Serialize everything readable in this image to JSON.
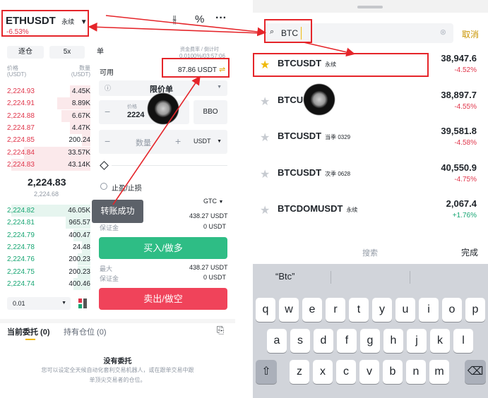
{
  "left": {
    "pair": "ETHUSDT",
    "pair_tag": "永续",
    "pair_change": "-6.53%",
    "funding": "资金费率 / 倒计时",
    "funding_value": "0.0100%/03:57:06",
    "margin_mode": "逐仓",
    "leverage": "5x",
    "position_mode": "单",
    "col_price": "价格",
    "col_price_unit": "(USDT)",
    "col_qty": "数量",
    "col_qty_unit": "(USDT)",
    "asks": [
      {
        "price": "2,224.93",
        "qty": "4.45K",
        "depth": 0.25
      },
      {
        "price": "2,224.91",
        "qty": "8.89K",
        "depth": 0.4
      },
      {
        "price": "2,224.88",
        "qty": "6.67K",
        "depth": 0.35
      },
      {
        "price": "2,224.87",
        "qty": "4.47K",
        "depth": 0.25
      },
      {
        "price": "2,224.85",
        "qty": "200.24",
        "depth": 0.1
      },
      {
        "price": "2,224.84",
        "qty": "33.57K",
        "depth": 0.8
      },
      {
        "price": "2,224.83",
        "qty": "43.14K",
        "depth": 0.95
      }
    ],
    "last_price": "2,224.83",
    "mark_price": "2,224.68",
    "bids": [
      {
        "price": "2,224.82",
        "qty": "46.05K",
        "depth": 0.95
      },
      {
        "price": "2,224.81",
        "qty": "965.57",
        "depth": 0.3
      },
      {
        "price": "2,224.79",
        "qty": "400.47",
        "depth": 0.2
      },
      {
        "price": "2,224.78",
        "qty": "24.48",
        "depth": 0.1
      },
      {
        "price": "2,224.76",
        "qty": "200.23",
        "depth": 0.15
      },
      {
        "price": "2,224.75",
        "qty": "200.23",
        "depth": 0.15
      },
      {
        "price": "2,224.74",
        "qty": "400.46",
        "depth": 0.2
      }
    ],
    "tick_size": "0.01",
    "available_label": "可用",
    "available_value": "87.86 USDT",
    "order_type": "限价单",
    "price_label": "价格",
    "price_value": "2224",
    "bbo": "BBO",
    "qty_label": "数量",
    "qty_unit": "USDT",
    "tpsl_label": "止盈/止损",
    "tif": "GTC",
    "toast": "转账成功",
    "buy_max_value": "438.27 USDT",
    "buy_margin_label": "保证金",
    "buy_margin_value": "0 USDT",
    "buy_button": "买入/做多",
    "sell_max_label": "最大",
    "sell_max_value": "438.27 USDT",
    "sell_margin_label": "保证金",
    "sell_margin_value": "0 USDT",
    "sell_button": "卖出/做空",
    "tab_open_orders": "当前委托 (0)",
    "tab_positions": "持有仓位 (0)",
    "empty_title": "没有委托",
    "empty_desc_1": "您可以设定全天候自动化套利交易机器人，或在跟单交易中跟",
    "empty_desc_2": "单顶尖交易者的仓位。"
  },
  "right": {
    "search_value": "BTC",
    "cancel": "取消",
    "results": [
      {
        "symbol": "BTCUSDT",
        "tag": "永续",
        "price": "38,947.6",
        "change": "-4.52%",
        "starred": true
      },
      {
        "symbol": "BTCU",
        "tag": "",
        "price": "38,897.7",
        "change": "-4.55%",
        "starred": false
      },
      {
        "symbol": "BTCUSDT",
        "tag": "当季 0329",
        "price": "39,581.8",
        "change": "-4.58%",
        "starred": false
      },
      {
        "symbol": "BTCUSDT",
        "tag": "次季 0628",
        "price": "40,550.9",
        "change": "-4.75%",
        "starred": false
      },
      {
        "symbol": "BTCDOMUSDT",
        "tag": "永续",
        "price": "2,067.4",
        "change": "+1.76%",
        "starred": false
      }
    ],
    "kbd_search": "搜索",
    "kbd_done": "完成",
    "suggestion": "“Btc”",
    "row1": [
      "q",
      "w",
      "e",
      "r",
      "t",
      "y",
      "u",
      "i",
      "o",
      "p"
    ],
    "row2": [
      "a",
      "s",
      "d",
      "f",
      "g",
      "h",
      "j",
      "k",
      "l"
    ],
    "row3": [
      "z",
      "x",
      "c",
      "v",
      "b",
      "n",
      "m"
    ]
  },
  "colors": {
    "annotation": "#e5252a",
    "buy": "#2ebd85",
    "sell": "#f0435a"
  }
}
